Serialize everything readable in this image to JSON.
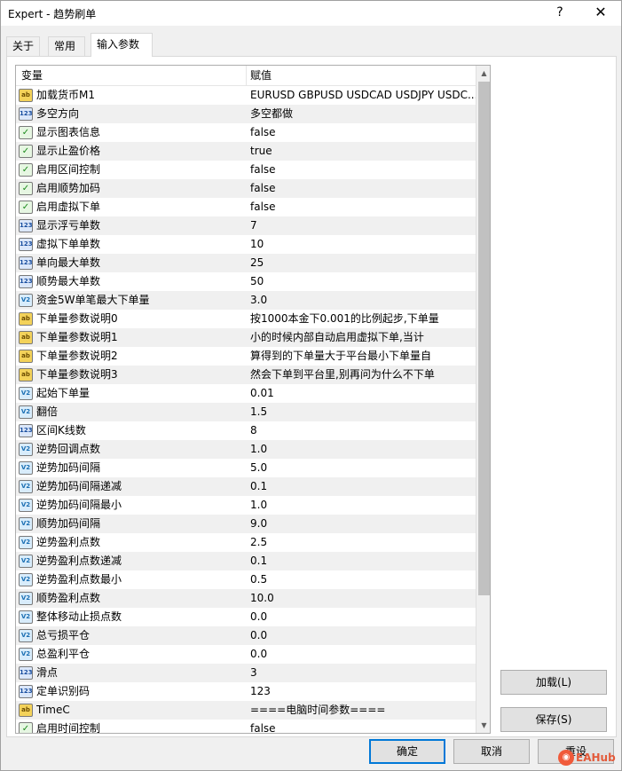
{
  "window": {
    "title": "Expert - 趋势刷单",
    "help_label": "?",
    "close_label": "✕"
  },
  "tabs": [
    {
      "label": "关于",
      "active": false
    },
    {
      "label": "常用",
      "active": false
    },
    {
      "label": "输入参数",
      "active": true
    }
  ],
  "grid": {
    "col_variable": "变量",
    "col_value": "赋值",
    "rows": [
      {
        "icon": "ab",
        "name": "加载货币M1",
        "value": "EURUSD GBPUSD USDCAD USDJPY USDC..."
      },
      {
        "icon": "enum",
        "name": "多空方向",
        "value": "多空都做"
      },
      {
        "icon": "bool",
        "name": "显示图表信息",
        "value": "false"
      },
      {
        "icon": "bool",
        "name": "显示止盈价格",
        "value": "true"
      },
      {
        "icon": "bool",
        "name": "启用区间控制",
        "value": "false"
      },
      {
        "icon": "bool",
        "name": "启用顺势加码",
        "value": "false"
      },
      {
        "icon": "bool",
        "name": "启用虚拟下单",
        "value": "false"
      },
      {
        "icon": "num",
        "name": "显示浮亏单数",
        "value": "7"
      },
      {
        "icon": "num",
        "name": "虚拟下单单数",
        "value": "10"
      },
      {
        "icon": "num",
        "name": "单向最大单数",
        "value": "25"
      },
      {
        "icon": "num",
        "name": "顺势最大单数",
        "value": "50"
      },
      {
        "icon": "dbl",
        "name": "资金5W单笔最大下单量",
        "value": "3.0"
      },
      {
        "icon": "ab",
        "name": "下单量参数说明0",
        "value": "按1000本金下0.001的比例起步,下单量"
      },
      {
        "icon": "ab",
        "name": "下单量参数说明1",
        "value": "小的时候内部自动启用虚拟下单,当计"
      },
      {
        "icon": "ab",
        "name": "下单量参数说明2",
        "value": "算得到的下单量大于平台最小下单量自"
      },
      {
        "icon": "ab",
        "name": "下单量参数说明3",
        "value": "然会下单到平台里,别再问为什么不下单"
      },
      {
        "icon": "dbl",
        "name": "起始下单量",
        "value": "0.01"
      },
      {
        "icon": "dbl",
        "name": "翻倍",
        "value": "1.5"
      },
      {
        "icon": "num",
        "name": "区间K线数",
        "value": "8"
      },
      {
        "icon": "dbl",
        "name": "逆势回调点数",
        "value": "1.0"
      },
      {
        "icon": "dbl",
        "name": "逆势加码间隔",
        "value": "5.0"
      },
      {
        "icon": "dbl",
        "name": "逆势加码间隔递减",
        "value": "0.1"
      },
      {
        "icon": "dbl",
        "name": "逆势加码间隔最小",
        "value": "1.0"
      },
      {
        "icon": "dbl",
        "name": "顺势加码间隔",
        "value": "9.0"
      },
      {
        "icon": "dbl",
        "name": "逆势盈利点数",
        "value": "2.5"
      },
      {
        "icon": "dbl",
        "name": "逆势盈利点数递减",
        "value": "0.1"
      },
      {
        "icon": "dbl",
        "name": "逆势盈利点数最小",
        "value": "0.5"
      },
      {
        "icon": "dbl",
        "name": "顺势盈利点数",
        "value": "10.0"
      },
      {
        "icon": "dbl",
        "name": "整体移动止损点数",
        "value": "0.0"
      },
      {
        "icon": "dbl",
        "name": "总亏损平仓",
        "value": "0.0"
      },
      {
        "icon": "dbl",
        "name": "总盈利平仓",
        "value": "0.0"
      },
      {
        "icon": "num",
        "name": "滑点",
        "value": "3"
      },
      {
        "icon": "num",
        "name": "定单识别码",
        "value": "123"
      },
      {
        "icon": "ab",
        "name": "TimeC",
        "value": "====电脑时间参数===="
      },
      {
        "icon": "bool",
        "name": "启用时间控制",
        "value": "false"
      }
    ],
    "icon_glyphs": {
      "ab": "ab",
      "num": "123",
      "dbl": "V2",
      "bool": "✓",
      "enum": "123"
    }
  },
  "buttons": {
    "load": "加载(L)",
    "save": "保存(S)",
    "ok": "确定",
    "cancel": "取消",
    "reset": "重设"
  },
  "watermark": {
    "text": "EAHub"
  }
}
